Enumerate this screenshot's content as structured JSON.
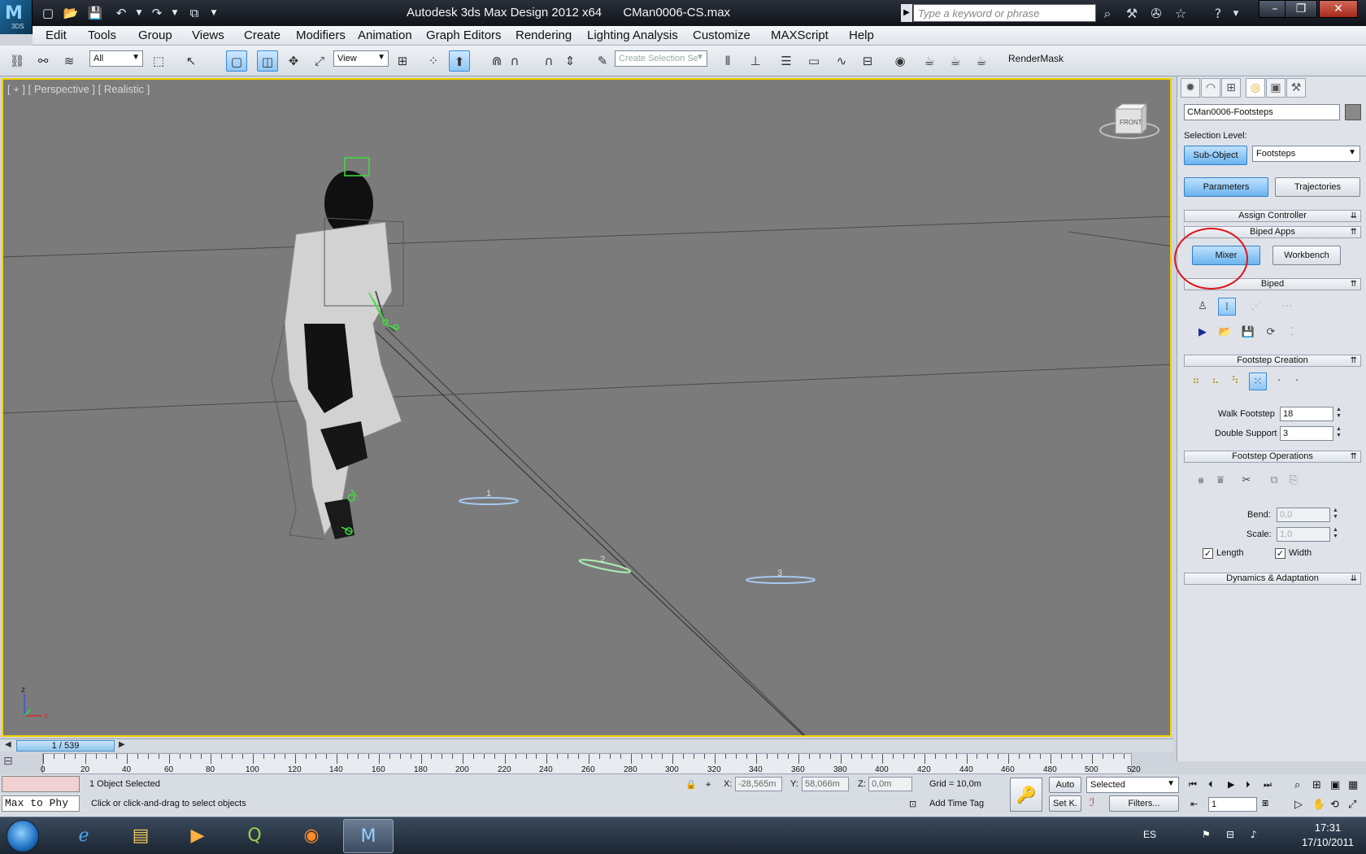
{
  "window": {
    "app_title": "Autodesk 3ds Max Design 2012 x64",
    "file_name": "CMan0006-CS.max",
    "logo_sub": "3DS",
    "search_placeholder": "Type a keyword or phrase"
  },
  "menu": [
    "Edit",
    "Tools",
    "Group",
    "Views",
    "Create",
    "Modifiers",
    "Animation",
    "Graph Editors",
    "Rendering",
    "Lighting Analysis",
    "Customize",
    "MAXScript",
    "Help"
  ],
  "toolbar": {
    "selection_filter": "All",
    "reference_coord": "View",
    "named_selection_placeholder": "Create Selection Se",
    "render_mask": "RenderMask"
  },
  "viewport": {
    "label": "[ + ] [ Perspective ] [ Realistic ]",
    "viewcube_label": "FRONT",
    "footstep_numbers": [
      "1",
      "2",
      "3"
    ],
    "axis_x": "x",
    "axis_z": "z"
  },
  "command_panel": {
    "object_name": "CMan0006-Footsteps",
    "selection_level_label": "Selection Level:",
    "sub_object_button": "Sub-Object",
    "selection_level_value": "Footsteps",
    "parameters_button": "Parameters",
    "trajectories_button": "Trajectories",
    "rollouts": {
      "assign_controller": "Assign Controller",
      "biped_apps": "Biped Apps",
      "biped": "Biped",
      "footstep_creation": "Footstep Creation",
      "footstep_operations": "Footstep Operations",
      "dynamics": "Dynamics & Adaptation"
    },
    "mixer_button": "Mixer",
    "workbench_button": "Workbench",
    "walk_footstep_label": "Walk Footstep",
    "walk_footstep_value": "18",
    "double_support_label": "Double Support",
    "double_support_value": "3",
    "bend_label": "Bend:",
    "bend_value": "0,0",
    "scale_label": "Scale:",
    "scale_value": "1,0",
    "length_label": "Length",
    "length_checked": true,
    "width_label": "Width",
    "width_checked": true
  },
  "timeline": {
    "frame_display": "1 / 539",
    "ticks": [
      "0",
      "20",
      "40",
      "60",
      "80",
      "100",
      "120",
      "140",
      "160",
      "180",
      "200",
      "220",
      "240",
      "260",
      "280",
      "300",
      "320",
      "340",
      "360",
      "380",
      "400",
      "420",
      "440",
      "460",
      "480",
      "500",
      "520"
    ]
  },
  "status": {
    "maxscript_text": "Max to Phy",
    "selection_status": "1 Object Selected",
    "prompt": "Click or click-and-drag to select objects",
    "x_label": "X:",
    "x_value": "-28,565m",
    "y_label": "Y:",
    "y_value": "58,066m",
    "z_label": "Z:",
    "z_value": "0,0m",
    "grid": "Grid = 10,0m",
    "add_time_tag": "Add Time Tag",
    "auto_key": "Auto",
    "set_key": "Set K.",
    "key_filter_value": "Selected",
    "filters": "Filters...",
    "current_frame": "1"
  },
  "taskbar": {
    "language": "ES",
    "time": "17:31",
    "date": "17/10/2011"
  },
  "colors": {
    "viewport_bg": "#7b7b7b",
    "viewport_border": "#f4d200",
    "highlight_circle": "#e0141a",
    "bone_green": "#3ee03e",
    "footstep_blue": "#a8c8f0"
  }
}
